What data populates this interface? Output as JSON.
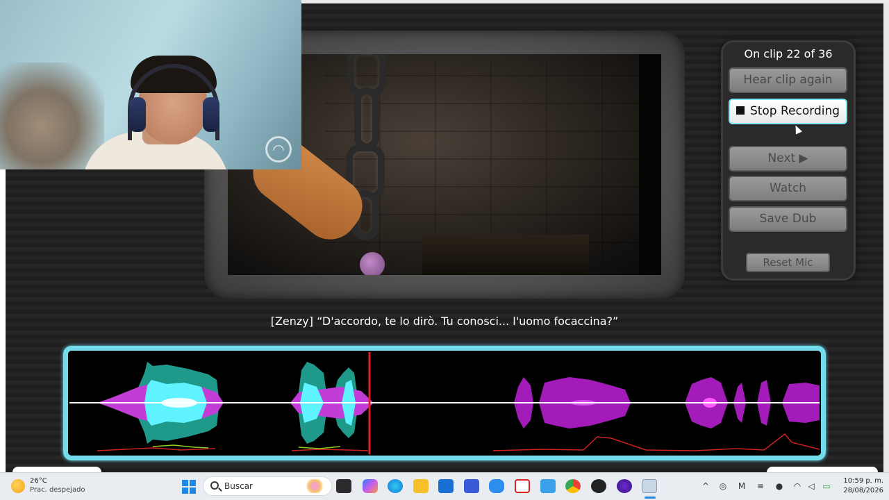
{
  "panel": {
    "clip_counter": "On clip 22 of 36",
    "hear_clip_again_label": "Hear clip again",
    "stop_recording_label": "Stop Recording",
    "next_label": "Next ▶",
    "watch_label": "Watch",
    "save_dub_label": "Save Dub",
    "reset_mic_label": "Reset Mic"
  },
  "subtitle": "[Zenzy] “D'accordo, te lo dirò. Tu conosci... l'uomo focaccina?”",
  "waveform": {
    "playhead_position_fraction": 0.4,
    "colors": {
      "frame": "#72dcec",
      "recorded_cyan": "#5ff3ff",
      "recorded_teal": "#1f9a8a",
      "reference_magenta": "#b020c8",
      "playhead": "#e02020",
      "baseline": "#ffffff"
    }
  },
  "taskbar": {
    "weather_temp": "26°C",
    "weather_condition": "Prac. despejado",
    "search_placeholder": "Buscar",
    "clock_time": "10:59 p. m.",
    "clock_date": "28/08/2026"
  },
  "icons": {
    "start": "windows-start-icon",
    "search": "search-icon",
    "weather": "sun-icon",
    "stop": "stop-square-icon",
    "webcam_overlay": "streaming-logo-icon"
  }
}
